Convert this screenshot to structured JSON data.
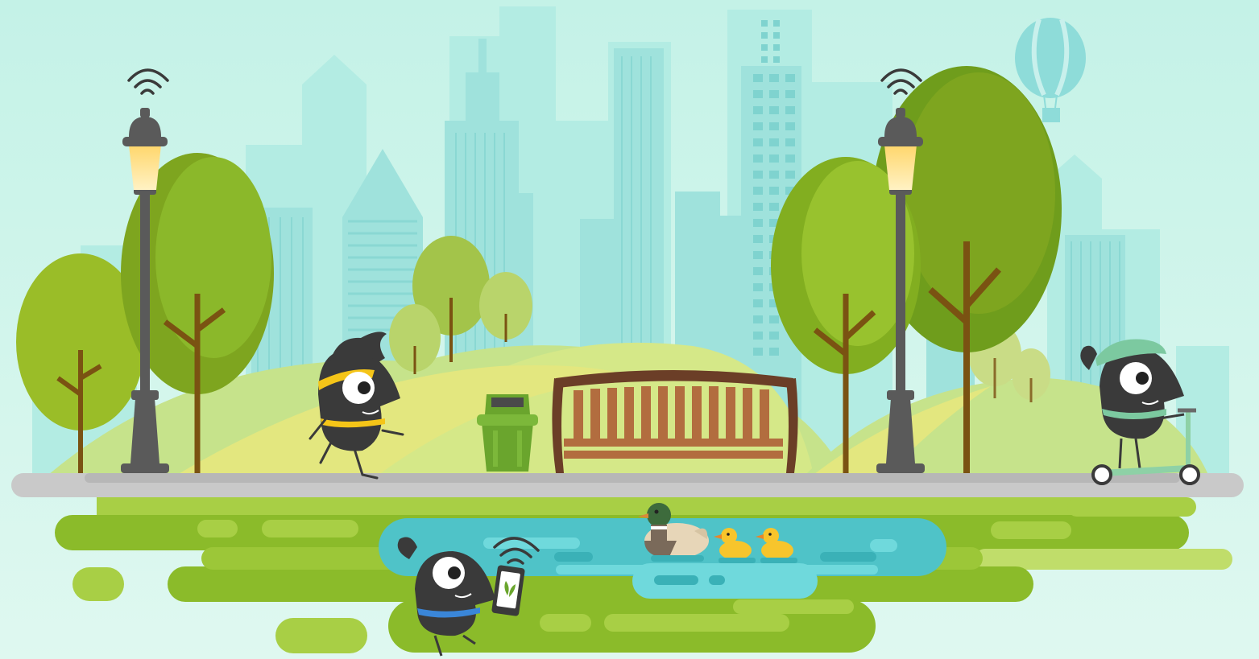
{
  "scene": {
    "colors": {
      "sky_top": "#c4f2e7",
      "sky_bottom": "#d6f7ee",
      "building_far": "#b0ebe2",
      "building_near": "#95ddd8",
      "building_window": "#6fcfcc",
      "hill_light": "#c3e28a",
      "hill_path": "#e2e67f",
      "tree_light": "#8ab929",
      "tree_dark": "#6f9d1c",
      "trunk": "#7a5212",
      "lamp_gray": "#5a5a5a",
      "lamp_glow": "#ffd66b",
      "sidewalk": "#c9c9c9",
      "grass_dark": "#8bbb2a",
      "grass_light": "#a8cf45",
      "pond": "#4fc3c8",
      "pond_light": "#6fd9dc",
      "bench_wood": "#b26d3f",
      "bench_frame": "#6b3e27",
      "bin_green": "#6aa52d",
      "character_body": "#3a3a3a",
      "headband_yellow": "#f5c518",
      "band_blue": "#3a86d8",
      "helmet_green": "#7cc9a0",
      "scooter_green": "#8ed1a6",
      "duck_yellow": "#f7c52c",
      "duck_head": "#3d6b3c",
      "duck_body": "#e7d6b8",
      "balloon": "#7fd7d6"
    },
    "icons": [
      "wifi-signal-icon",
      "smartphone-icon",
      "hot-air-balloon-icon"
    ]
  }
}
